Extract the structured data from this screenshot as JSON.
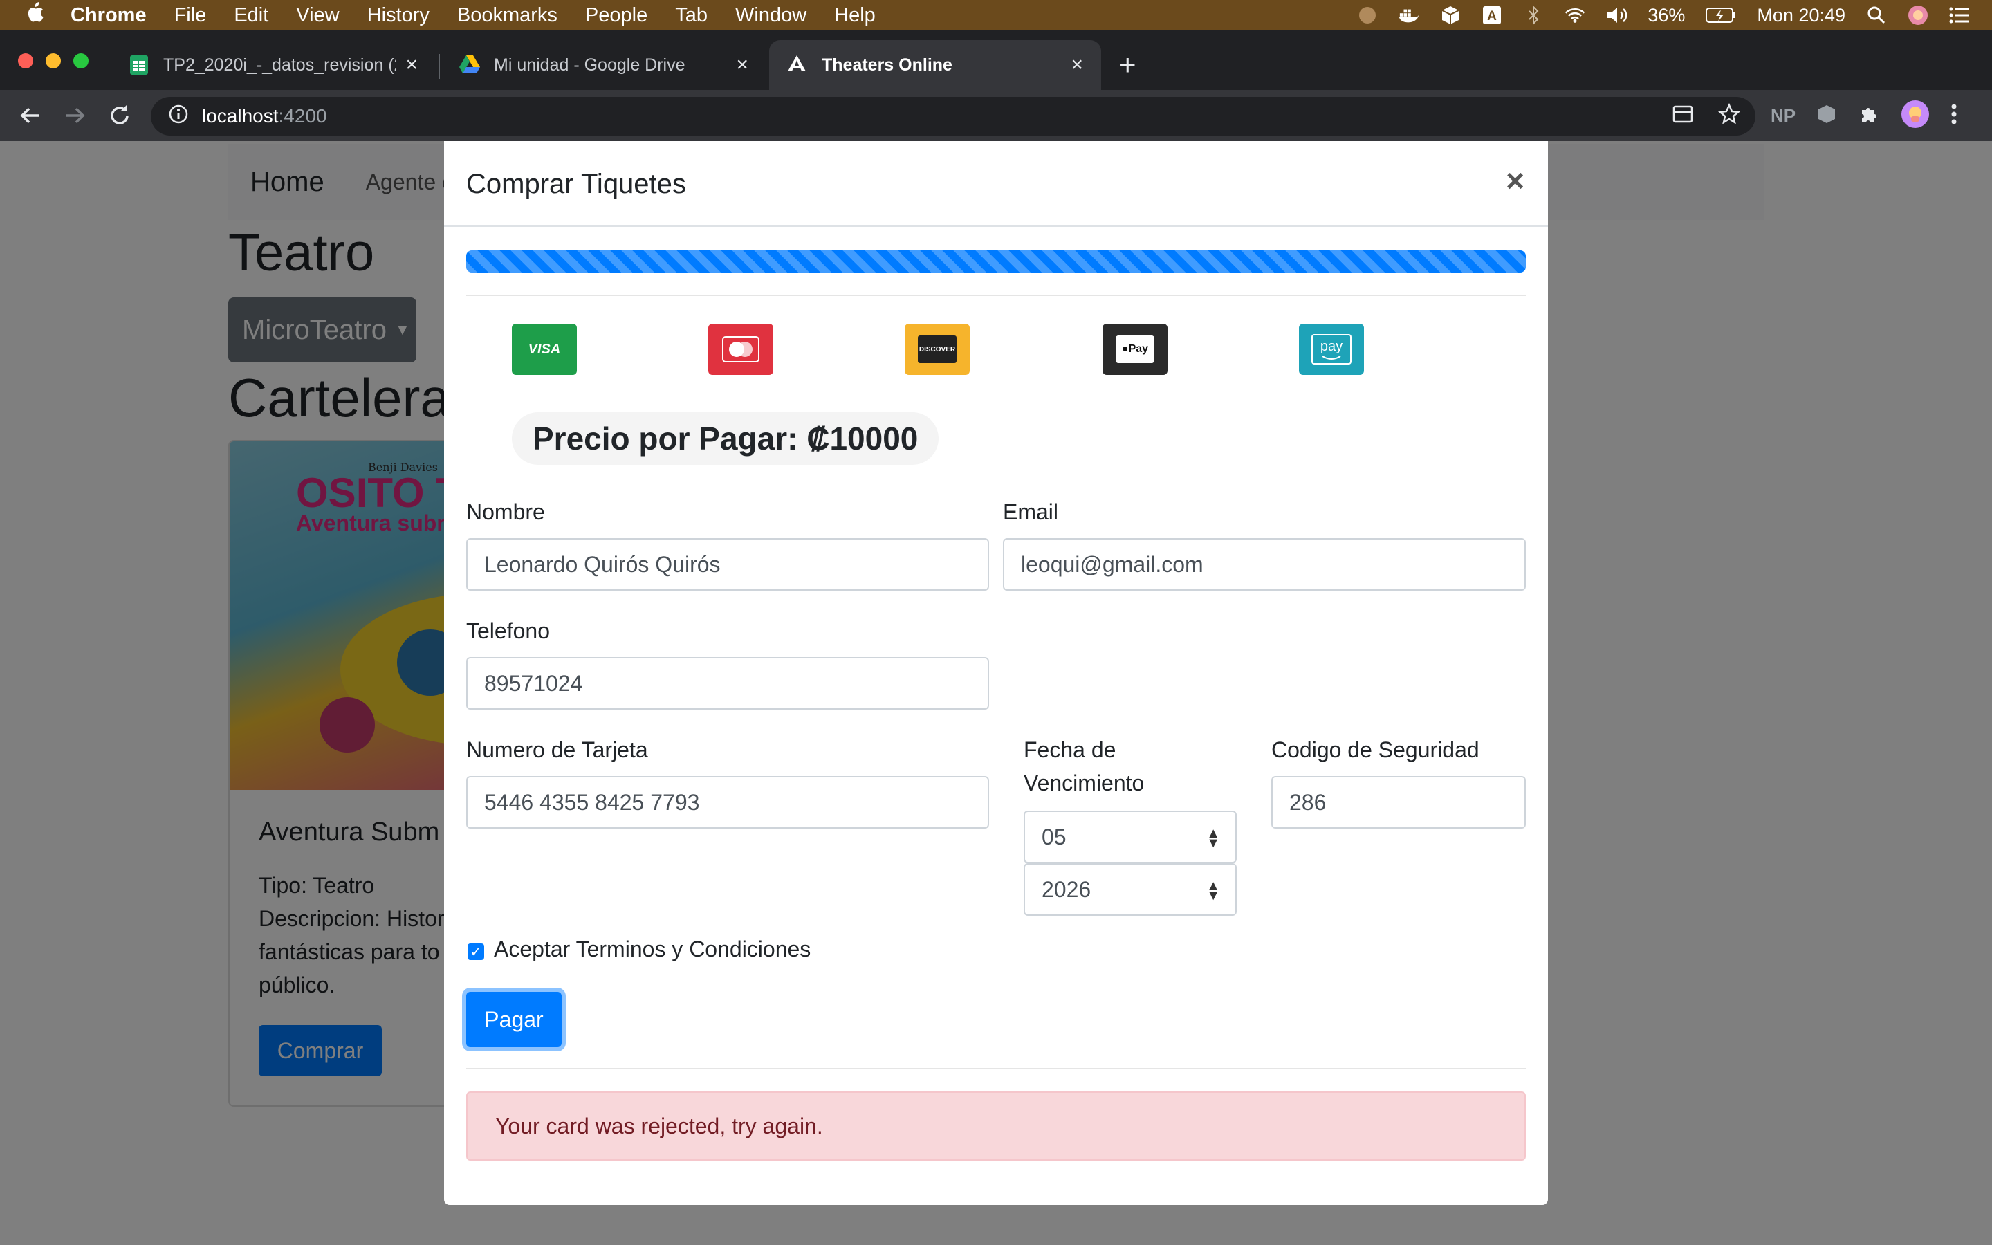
{
  "menubar": {
    "app": "Chrome",
    "items": [
      "File",
      "Edit",
      "View",
      "History",
      "Bookmarks",
      "People",
      "Tab",
      "Window",
      "Help"
    ],
    "battery": "36%",
    "clock": "Mon 20:49"
  },
  "tabs": [
    {
      "title": "TP2_2020i_-_datos_revision (2",
      "favicon": "sheets-icon",
      "active": false
    },
    {
      "title": "Mi unidad - Google Drive",
      "favicon": "drive-icon",
      "active": false
    },
    {
      "title": "Theaters Online",
      "favicon": "angular-icon",
      "active": true
    }
  ],
  "address": {
    "host": "localhost",
    "port": ":4200"
  },
  "extensions": {
    "np_label": "NP"
  },
  "background": {
    "nav_brand": "Home",
    "nav_link": "Agente c",
    "heading": "Teatro",
    "dropdown": "MicroTeatro",
    "section": "Cartelera",
    "card": {
      "title": "Aventura Subm",
      "type": "Tipo: Teatro",
      "desc_1": "Descripcion: Histor",
      "desc_2": "fantásticas para to",
      "desc_3": "público.",
      "button": "Comprar",
      "poster_author": "Benji Davies",
      "poster_title": "OSITO T",
      "poster_subtitle": "Aventura subm"
    }
  },
  "modal": {
    "title": "Comprar Tiquetes",
    "close": "×",
    "progress": 1.0,
    "payment_methods": [
      {
        "name": "visa-icon",
        "label": "VISA",
        "color": "#1e9e4a"
      },
      {
        "name": "mastercard-icon",
        "label": "",
        "color": "#e0323f"
      },
      {
        "name": "discover-icon",
        "label": "DISCOVER",
        "color": "#f6b42c"
      },
      {
        "name": "apple-pay-icon",
        "label": "Pay",
        "color": "#2b2b2b"
      },
      {
        "name": "amazon-pay-icon",
        "label": "pay",
        "color": "#1ea3b8"
      }
    ],
    "price": "Precio por Pagar: ₡10000",
    "fields": {
      "nombre_label": "Nombre",
      "nombre_value": "Leonardo Quirós Quirós",
      "email_label": "Email",
      "email_value": "leoqui@gmail.com",
      "telefono_label": "Telefono",
      "telefono_value": "89571024",
      "tarjeta_label": "Numero de Tarjeta",
      "tarjeta_value": "5446 4355 8425 7793",
      "fecha_label_1": "Fecha de",
      "fecha_label_2": "Vencimiento",
      "month_value": "05",
      "year_value": "2026",
      "codigo_label": "Codigo de Seguridad",
      "codigo_value": "286"
    },
    "terms_label": "Aceptar Terminos y Condiciones",
    "terms_checked": true,
    "pay_button": "Pagar",
    "alert": "Your card was rejected, try again."
  },
  "colors": {
    "primary": "#007bff",
    "alert_bg": "#f8d7da",
    "alert_text": "#721c24"
  }
}
